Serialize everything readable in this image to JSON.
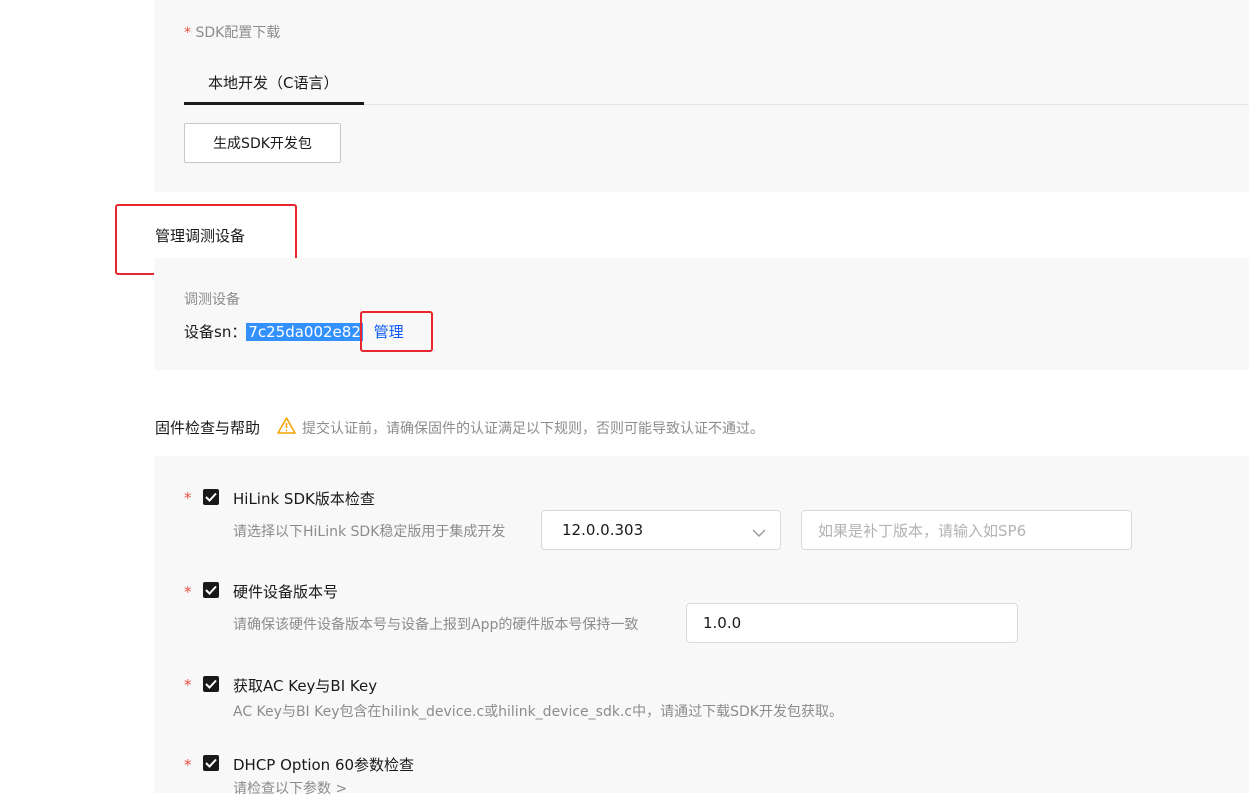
{
  "sdk": {
    "title": "SDK配置下载",
    "tab_label": "本地开发（C语言）",
    "generate_button": "生成SDK开发包"
  },
  "manage_debug": {
    "section_title": "管理调测设备",
    "subheading": "调测设备",
    "sn_label": "设备sn：",
    "sn_value": "7c25da002e82",
    "manage_link": "管理"
  },
  "firmware": {
    "title": "固件检查与帮助",
    "warning": "提交认证前，请确保固件的认证满足以下规则，否则可能导致认证不通过。",
    "items": [
      {
        "label": "HiLink SDK版本检查",
        "desc": "请选择以下HiLink SDK稳定版用于集成开发",
        "select_value": "12.0.0.303",
        "patch_placeholder": "如果是补丁版本，请输入如SP6"
      },
      {
        "label": "硬件设备版本号",
        "desc": "请确保该硬件设备版本号与设备上报到App的硬件版本号保持一致",
        "input_value": "1.0.0"
      },
      {
        "label": "获取AC Key与BI Key",
        "desc": "AC Key与BI Key包含在hilink_device.c或hilink_device_sdk.c中，请通过下载SDK开发包获取。"
      },
      {
        "label": "DHCP Option 60参数检查",
        "desc": "请检查以下参数 >"
      }
    ]
  },
  "colors": {
    "accent": "#0a59f7",
    "highlight_box": "#e8262f",
    "required": "#e84e40",
    "warning": "#f0a100"
  }
}
